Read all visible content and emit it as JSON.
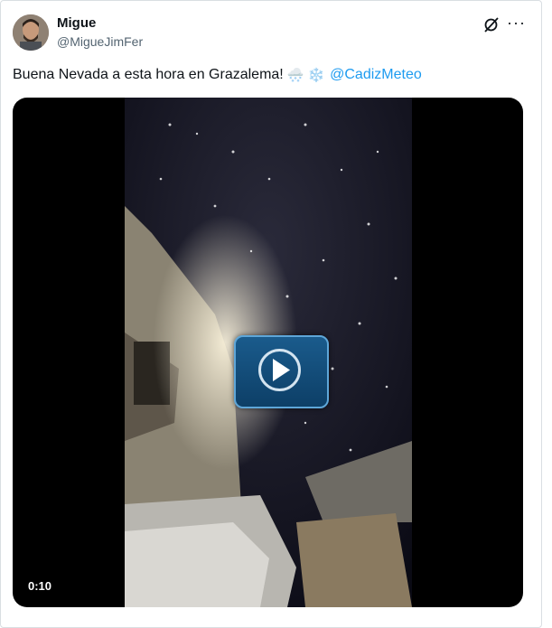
{
  "author": {
    "name": "Migue",
    "handle": "@MigueJimFer"
  },
  "icons": {
    "grok": "grok-icon",
    "more": "more-options-icon",
    "play": "play-icon"
  },
  "tweet": {
    "text": "Buena Nevada a esta hora en Grazalema!",
    "emojis": [
      "🌨️",
      "❄️"
    ],
    "mention": "@CadizMeteo"
  },
  "video": {
    "duration": "0:10"
  },
  "colors": {
    "link": "#1d9bf0",
    "secondary_text": "#536471",
    "play_button": "#1a5b8c"
  }
}
